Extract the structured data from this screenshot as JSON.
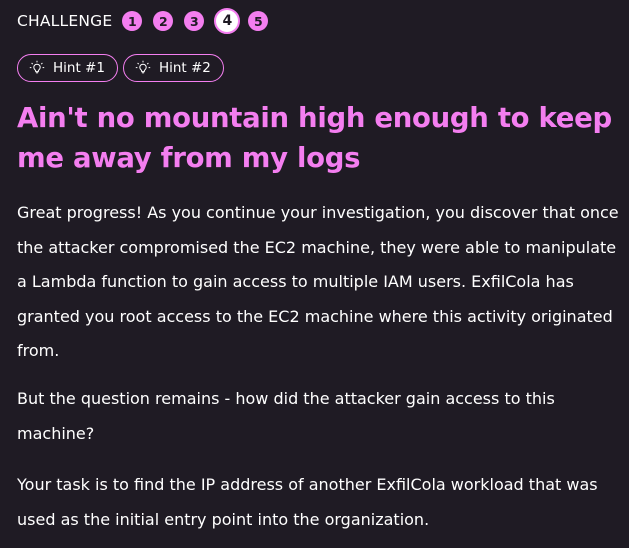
{
  "challenge": {
    "label": "CHALLENGE",
    "steps": [
      {
        "number": "1",
        "state": "completed"
      },
      {
        "number": "2",
        "state": "completed"
      },
      {
        "number": "3",
        "state": "completed"
      },
      {
        "number": "4",
        "state": "current"
      },
      {
        "number": "5",
        "state": "upcoming"
      }
    ]
  },
  "hints": [
    {
      "label": "Hint #1",
      "icon": "lightbulb-icon"
    },
    {
      "label": "Hint #2",
      "icon": "lightbulb-icon"
    }
  ],
  "title": "Ain't no mountain high enough to keep me away from my logs",
  "paragraphs": [
    "Great progress! As you continue your investigation, you discover that once the attacker compromised the EC2 machine, they were able to manipulate a Lambda function to gain access to multiple IAM users. ExfilCola has granted you root access to the EC2 machine where this activity originated from.",
    "But the question remains - how did the attacker gain access to this machine?",
    "Your task is to find the IP address of another ExfilCola workload that was used as the initial entry point into the organization."
  ],
  "colors": {
    "background": "#1f1b24",
    "accent": "#f47ef0",
    "text": "#ffffff"
  }
}
